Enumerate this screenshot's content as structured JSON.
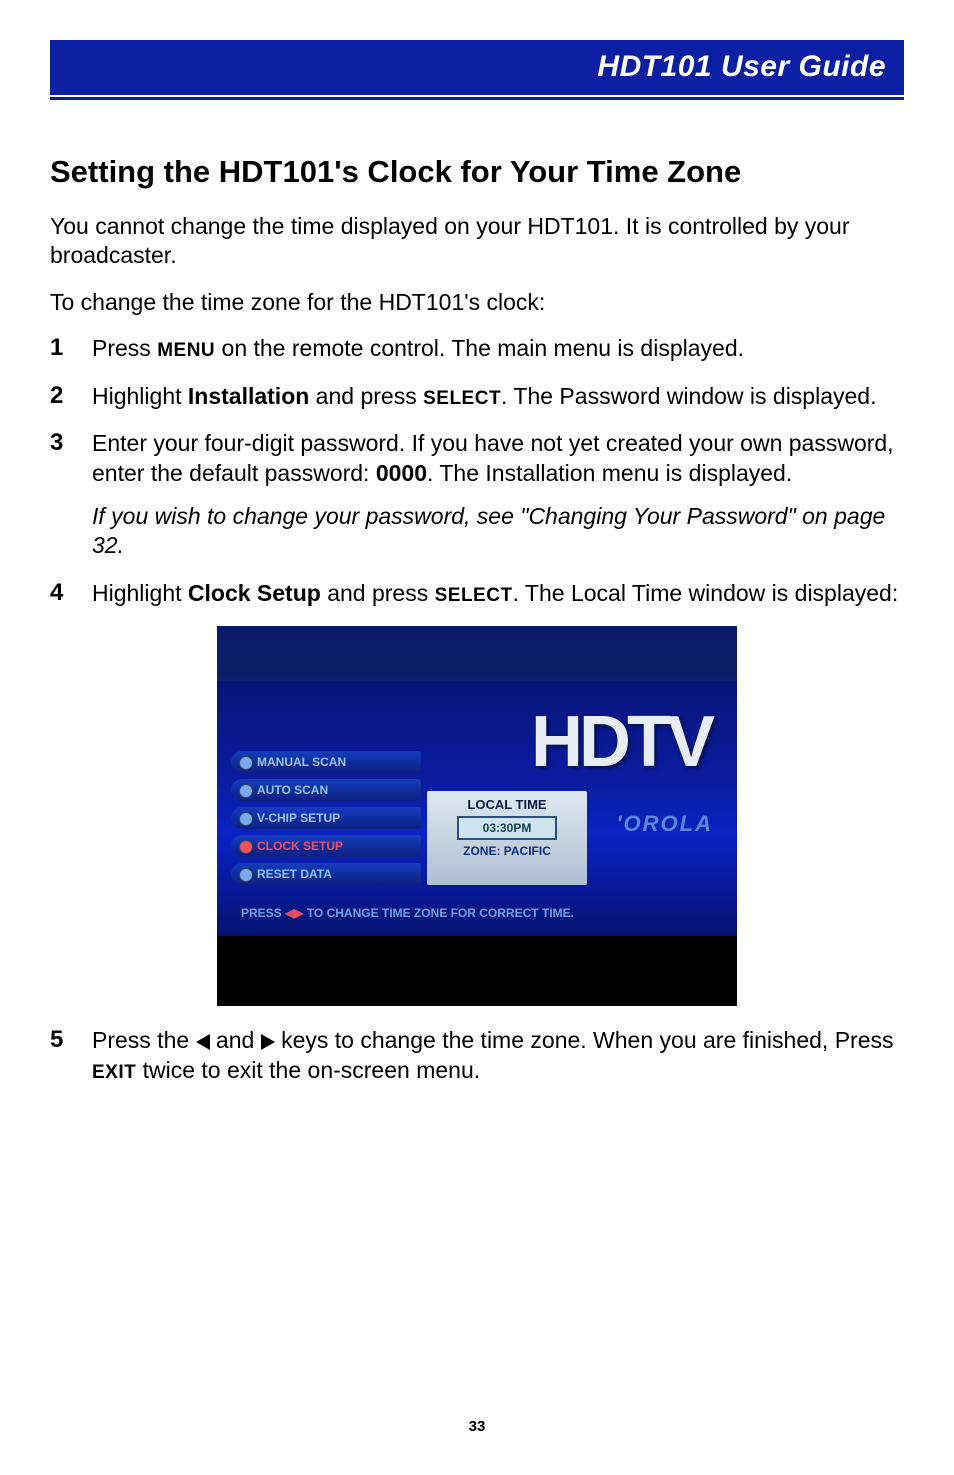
{
  "header": {
    "title": "HDT101 User Guide"
  },
  "section": {
    "heading": "Setting the HDT101's Clock for Your Time Zone",
    "intro1": "You cannot change the time displayed on your HDT101. It is controlled by your broadcaster.",
    "intro2": "To change the time zone for the HDT101's clock:"
  },
  "steps": {
    "s1_a": "Press ",
    "s1_menu": "MENU",
    "s1_b": " on the remote control. The main menu is displayed.",
    "s2_a": "Highlight ",
    "s2_install": "Installation",
    "s2_b": " and press ",
    "s2_select": "SELECT",
    "s2_c": ". The Password window is displayed.",
    "s3_a": "Enter your four-digit password. If you have not yet created your own password, enter the default password: ",
    "s3_pwd": "0000",
    "s3_b": ". The Installation menu is displayed.",
    "s3_note": "If you wish to change your password, see \"Changing Your Password\" on page 32.",
    "s4_a": "Highlight ",
    "s4_clock": "Clock Setup",
    "s4_b": " and press ",
    "s4_select": "SELECT",
    "s4_c": ". The Local Time window is displayed:",
    "s5_a": "Press the ",
    "s5_b": " and ",
    "s5_c": " keys to change the time zone. When you are finished, Press ",
    "s5_exit": "EXIT",
    "s5_d": " twice to exit the on-screen menu."
  },
  "screenshot": {
    "hdtv": "HDTV",
    "brand": "'OROLA",
    "menu": {
      "manual_scan": "MANUAL SCAN",
      "auto_scan": "AUTO SCAN",
      "vchip": "V-CHIP SETUP",
      "clock": "CLOCK SETUP",
      "reset": "RESET DATA"
    },
    "panel": {
      "title": "LOCAL TIME",
      "time": "03:30PM",
      "zone": "ZONE: PACIFIC"
    },
    "hint_a": "PRESS ",
    "hint_b": " TO CHANGE TIME ZONE FOR CORRECT TIME."
  },
  "footer": {
    "page": "33"
  }
}
